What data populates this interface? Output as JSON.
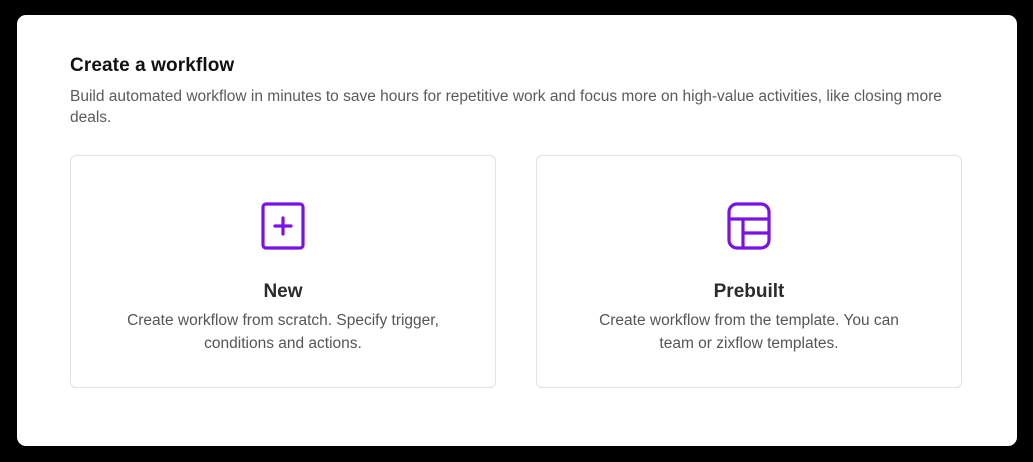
{
  "page": {
    "title": "Create a workflow",
    "subtitle": "Build automated workflow in minutes to save hours for repetitive work and focus more on high-value activities, like closing more deals."
  },
  "options": [
    {
      "title": "New",
      "description_line1": "Create workflow from scratch. Specify trigger,",
      "description_line2": "conditions and actions.",
      "icon": "plus-square-icon"
    },
    {
      "title": "Prebuilt",
      "description_line1": "Create workflow from the template. You can",
      "description_line2": "team or zixflow templates.",
      "icon": "layout-template-icon"
    }
  ],
  "colors": {
    "accent": "#7a12e8",
    "background": "#000000",
    "panel": "#ffffff",
    "card_border": "#e2e2e2"
  }
}
